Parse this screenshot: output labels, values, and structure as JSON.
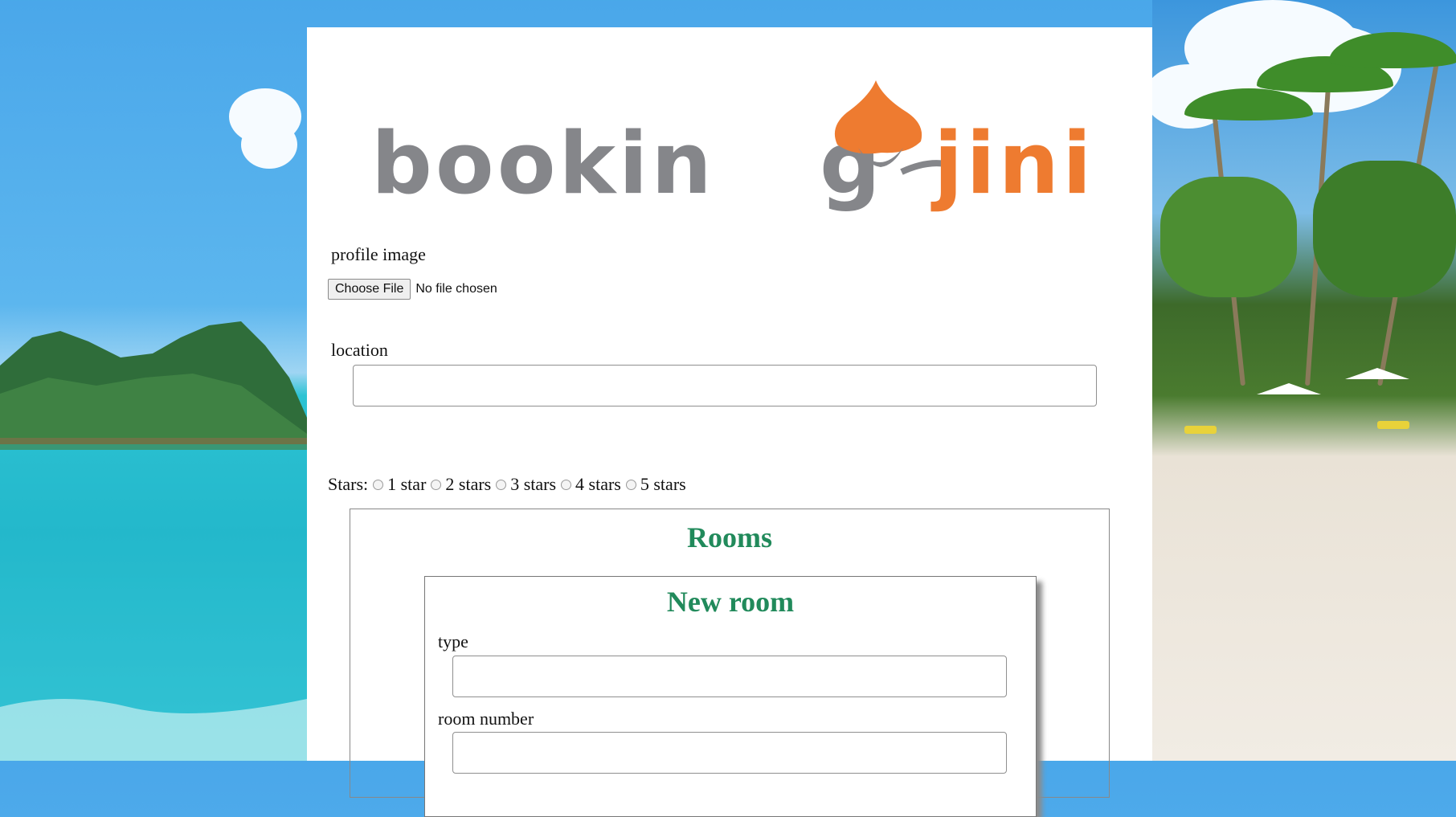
{
  "logo": {
    "text_gray": "bookin",
    "text_g": "g",
    "text_orange": "jini",
    "gray": "#85868a",
    "orange": "#ee7b30"
  },
  "form": {
    "profile_image_label": "profile image",
    "file_button_label": "Choose File",
    "file_status": "No file chosen",
    "location_label": "location",
    "location_value": "",
    "stars_label": "Stars:",
    "star_options": [
      "1 star",
      "2 stars",
      "3 stars",
      "4 stars",
      "5 stars"
    ]
  },
  "rooms": {
    "title": "Rooms",
    "new_room": {
      "title": "New room",
      "type_label": "type",
      "type_value": "",
      "room_number_label": "room number",
      "room_number_value": ""
    }
  },
  "colors": {
    "heading_green": "#218a5b",
    "panel_bg": "#ffffff"
  }
}
